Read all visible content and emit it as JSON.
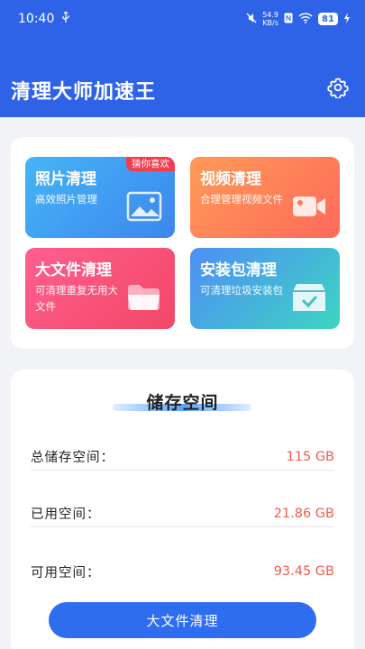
{
  "status": {
    "time": "10:40",
    "net_speed_value": "54.9",
    "net_speed_unit": "KB/s",
    "battery": "81"
  },
  "header": {
    "title": "清理大师加速王"
  },
  "tools": [
    {
      "title": "照片清理",
      "desc": "高效照片管理",
      "badge": "猜你喜欢",
      "icon": "image-icon"
    },
    {
      "title": "视频清理",
      "desc": "合理管理视频文件",
      "icon": "video-camera-icon"
    },
    {
      "title": "大文件清理",
      "desc": "可清理重复无用大文件",
      "icon": "folder-icon"
    },
    {
      "title": "安装包清理",
      "desc": "可清理垃圾安装包",
      "icon": "package-icon"
    }
  ],
  "storage": {
    "title": "储存空间",
    "total_label": "总储存空间：",
    "total_value": "115 GB",
    "used_label": "已用空间：",
    "used_value": "21.86 GB",
    "free_label": "可用空间：",
    "free_value": "93.45 GB",
    "button_label": "大文件清理"
  },
  "colors": {
    "primary": "#2f63e7",
    "value_red": "#f05d4f"
  }
}
